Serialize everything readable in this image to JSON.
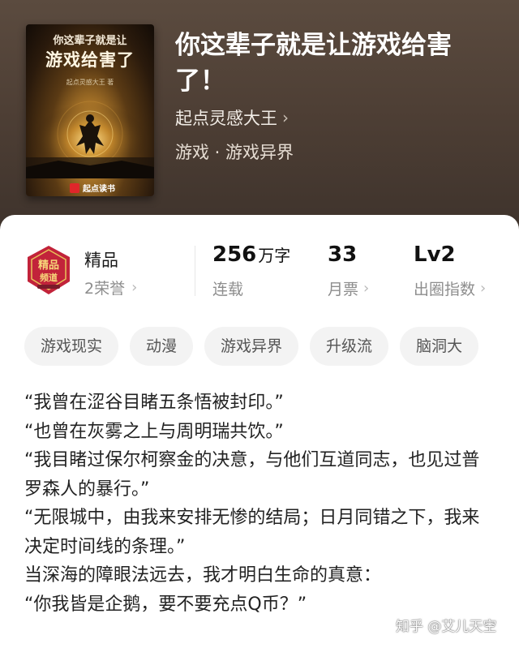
{
  "book": {
    "cover": {
      "title_line1": "你这辈子就是让",
      "title_line2": "游戏给害了",
      "author": "起点灵感大王 著",
      "publisher": "起点读书",
      "publisher_badge": "起点"
    },
    "title": "你这辈子就是让游戏给害了！",
    "author": "起点灵感大王",
    "genre": "游戏 · 游戏异界"
  },
  "stats": {
    "quality_label": "精品",
    "honor_text": "2荣誉",
    "word_count": "256",
    "word_count_unit": "万字",
    "status": "连载",
    "monthly_tickets": "33",
    "monthly_tickets_label": "月票",
    "level": "Lv2",
    "level_label": "出圈指数"
  },
  "tags": [
    "游戏现实",
    "动漫",
    "游戏异界",
    "升级流",
    "脑洞大"
  ],
  "synopsis": [
    "“我曾在涩谷目睹五条悟被封印。”",
    "“也曾在灰雾之上与周明瑞共饮。”",
    "“我目睹过保尔柯察金的决意，与他们互道同志，也见过普罗森人的暴行。”",
    "“无限城中，由我来安排无惨的结局；日月同错之下，我来决定时间线的条理。”",
    "当深海的障眼法远去，我才明白生命的真意：",
    "“你我皆是企鹅，要不要充点Q币？”"
  ],
  "watermark": "知乎 @艾儿天空",
  "colors": {
    "hero_bg": "#4e3f35",
    "badge_red": "#c2233a",
    "badge_gold": "#e8c35a",
    "tag_bg": "#f3f3f3"
  },
  "icons": {
    "chevron": "chevron-right-icon",
    "quality_badge": "jingpin-badge-icon"
  }
}
